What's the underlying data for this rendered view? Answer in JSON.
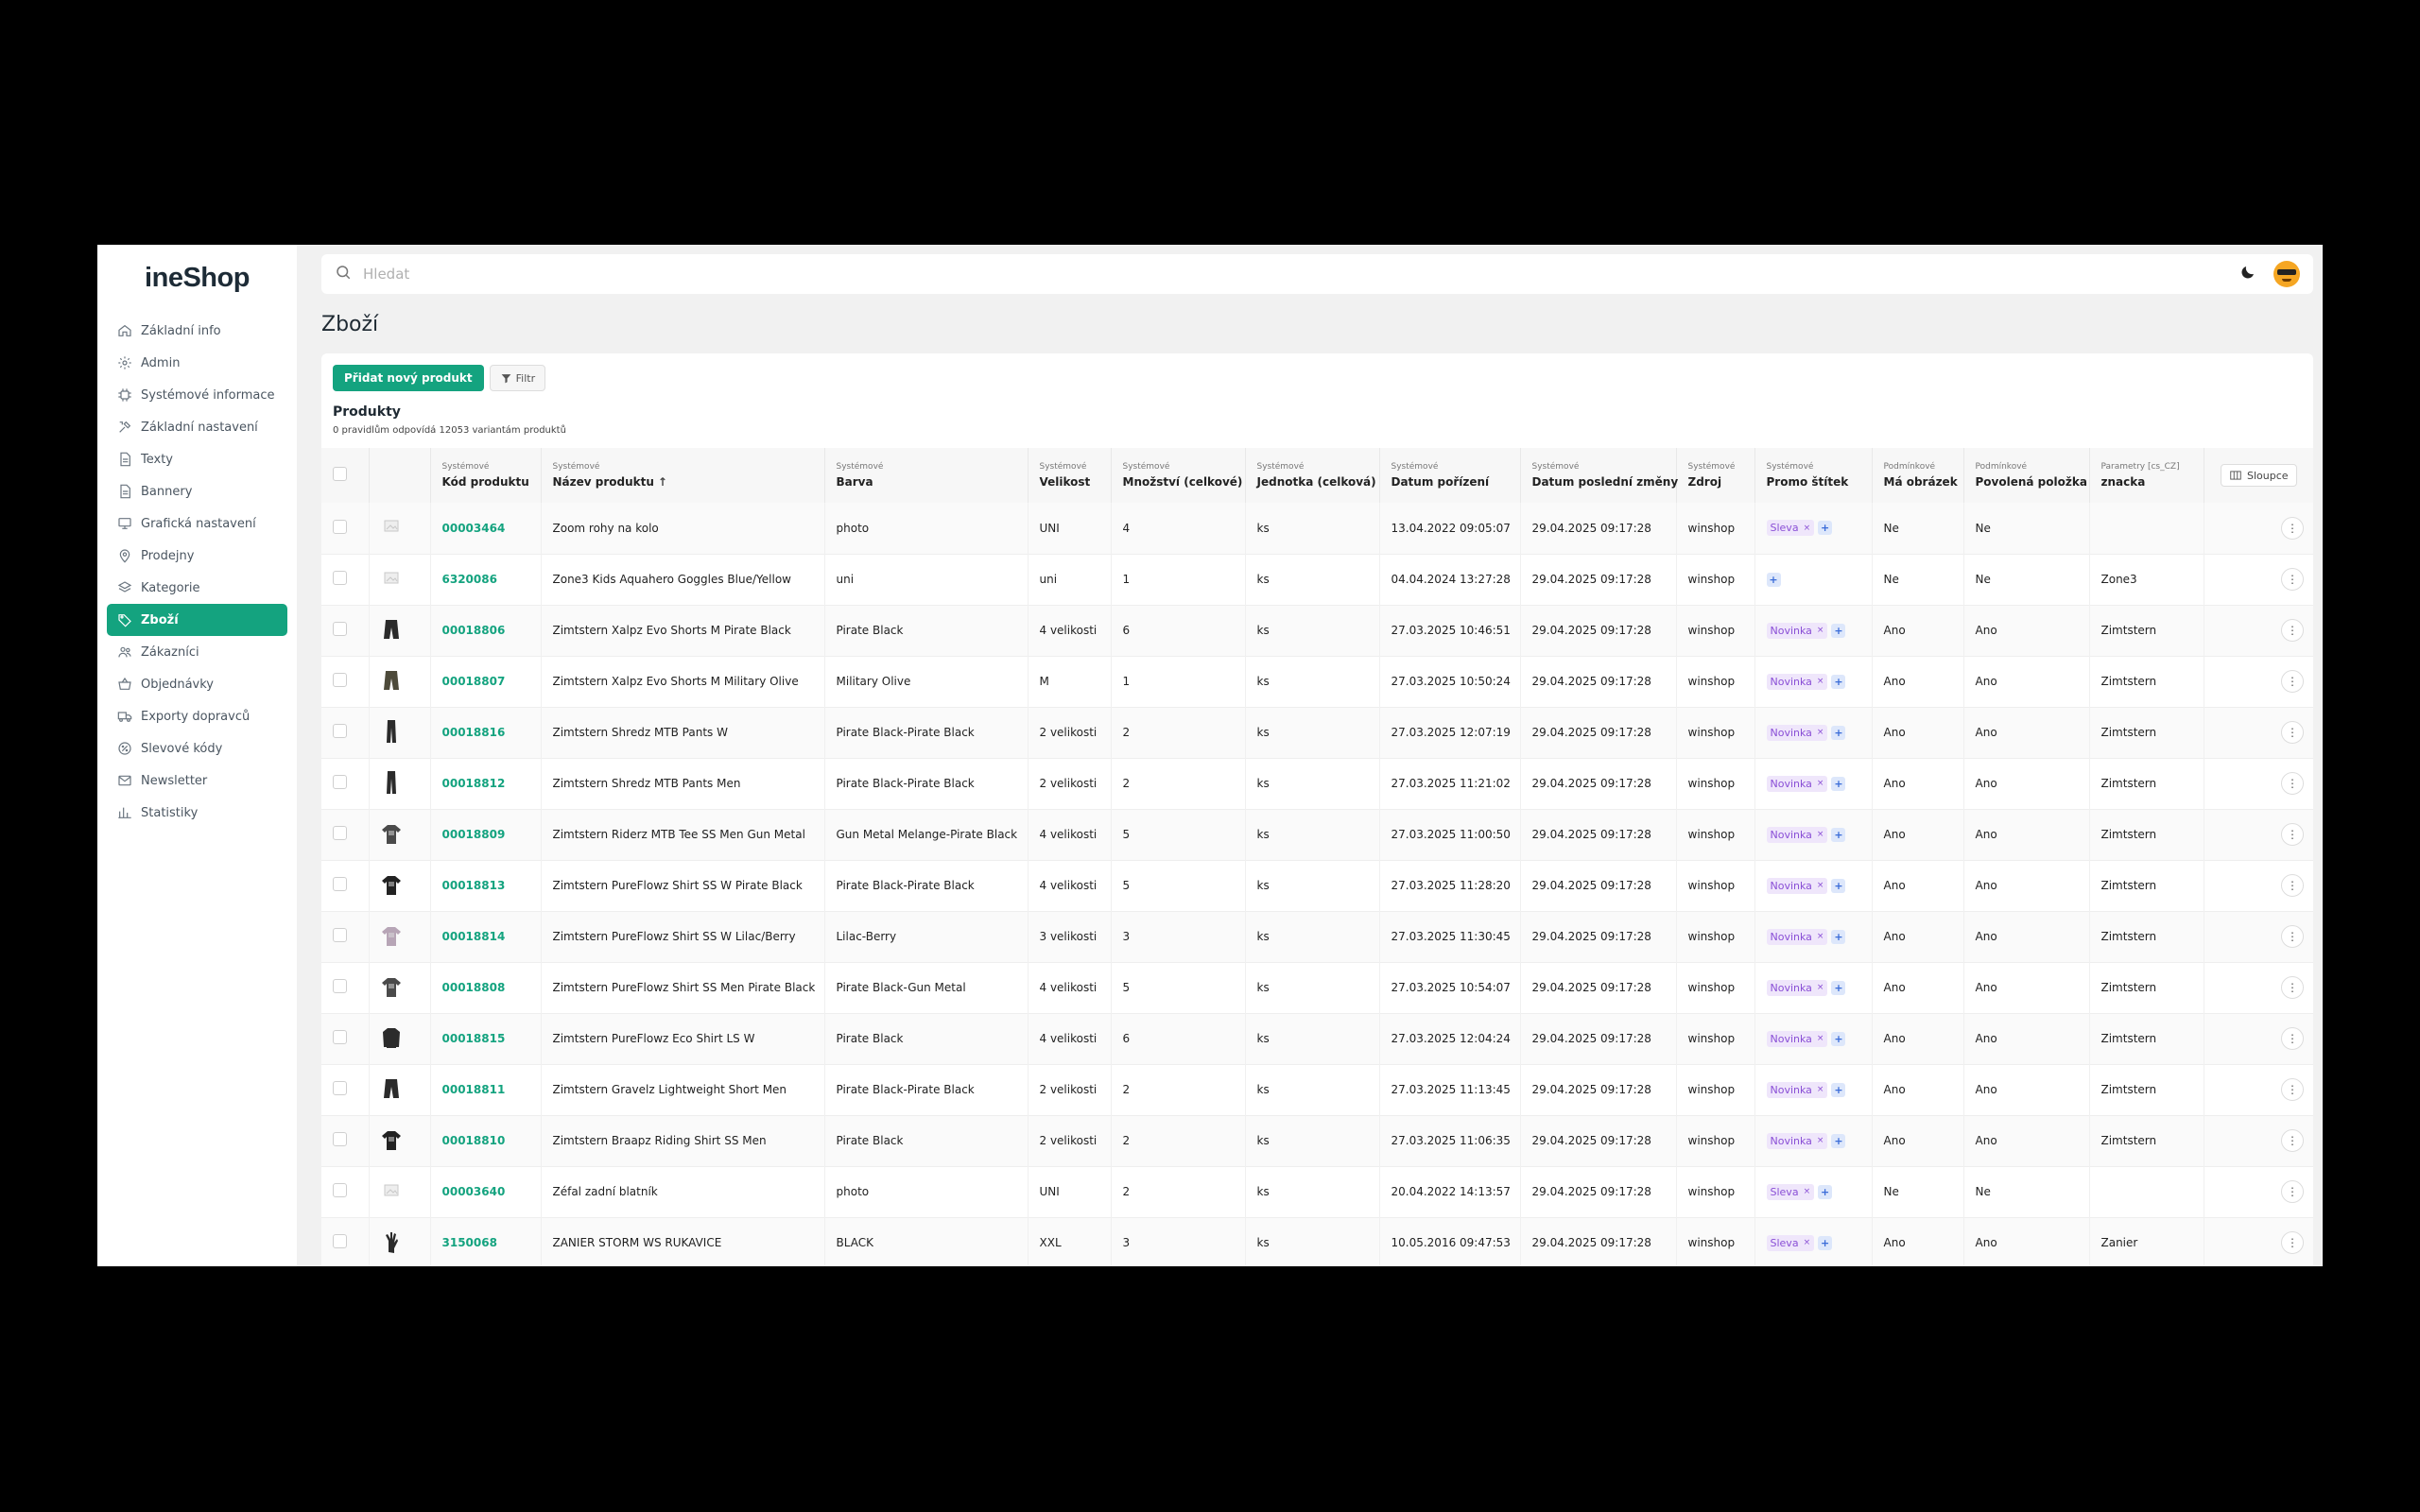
{
  "app": {
    "logo": "ineShop"
  },
  "colors": {
    "accent": "#14a37f",
    "tag_bg": "#efe6fb",
    "tag_text": "#8a4fd6",
    "plus_bg": "#dde7fb"
  },
  "sidebar": {
    "items": [
      {
        "label": "Základní info",
        "icon": "home-icon"
      },
      {
        "label": "Admin",
        "icon": "gear-icon"
      },
      {
        "label": "Systémové informace",
        "icon": "chip-icon"
      },
      {
        "label": "Základní nastavení",
        "icon": "tools-icon"
      },
      {
        "label": "Texty",
        "icon": "document-icon"
      },
      {
        "label": "Bannery",
        "icon": "document-icon"
      },
      {
        "label": "Grafická nastavení",
        "icon": "monitor-icon"
      },
      {
        "label": "Prodejny",
        "icon": "location-pin-icon"
      },
      {
        "label": "Kategorie",
        "icon": "layers-icon"
      },
      {
        "label": "Zboží",
        "icon": "tag-icon",
        "active": true
      },
      {
        "label": "Zákazníci",
        "icon": "users-icon"
      },
      {
        "label": "Objednávky",
        "icon": "basket-icon"
      },
      {
        "label": "Exporty dopravců",
        "icon": "truck-icon"
      },
      {
        "label": "Slevové kódy",
        "icon": "discount-icon"
      },
      {
        "label": "Newsletter",
        "icon": "mail-icon"
      },
      {
        "label": "Statistiky",
        "icon": "chart-icon"
      }
    ]
  },
  "search": {
    "placeholder": "Hledat"
  },
  "page": {
    "title": "Zboží"
  },
  "toolbar": {
    "add_label": "Přidat nový produkt",
    "filter_label": "Filtr"
  },
  "products": {
    "title": "Produkty",
    "subtitle": "0 pravidlům odpovídá 12053 variantám produktů",
    "columns_button": "Sloupce",
    "columns": [
      {
        "sys": "Systémové",
        "name": "Kód produktu"
      },
      {
        "sys": "Systémové",
        "name": "Název produktu"
      },
      {
        "sys": "Systémové",
        "name": "Barva"
      },
      {
        "sys": "Systémové",
        "name": "Velikost"
      },
      {
        "sys": "Systémové",
        "name": "Množství (celkové)"
      },
      {
        "sys": "Systémové",
        "name": "Jednotka (celková)"
      },
      {
        "sys": "Systémové",
        "name": "Datum pořízení"
      },
      {
        "sys": "Systémové",
        "name": "Datum poslední změny"
      },
      {
        "sys": "Systémové",
        "name": "Zdroj"
      },
      {
        "sys": "Systémové",
        "name": "Promo štítek"
      },
      {
        "sys": "Podmínkové",
        "name": "Má obrázek"
      },
      {
        "sys": "Podmínkové",
        "name": "Povolená položka"
      },
      {
        "sys": "Parametry [cs_CZ]",
        "name": "znacka"
      }
    ],
    "rows": [
      {
        "img": "placeholder",
        "code": "00003464",
        "name": "Zoom rohy na kolo",
        "color": "photo",
        "size": "UNI",
        "qty": "4",
        "unit": "ks",
        "date_acq": "13.04.2022 09:05:07",
        "date_mod": "29.04.2025 09:17:28",
        "source": "winshop",
        "promo": "Sleva",
        "has_img": "Ne",
        "allowed": "Ne",
        "brand": ""
      },
      {
        "img": "placeholder",
        "code": "6320086",
        "name": "Zone3 Kids Aquahero Goggles Blue/Yellow",
        "color": "uni",
        "size": "uni",
        "qty": "1",
        "unit": "ks",
        "date_acq": "04.04.2024 13:27:28",
        "date_mod": "29.04.2025 09:17:28",
        "source": "winshop",
        "promo": "",
        "has_img": "Ne",
        "allowed": "Ne",
        "brand": "Zone3"
      },
      {
        "img": "shorts",
        "code": "00018806",
        "name": "Zimtstern Xalpz Evo Shorts M Pirate Black",
        "color": "Pirate Black",
        "size": "4 velikosti",
        "qty": "6",
        "unit": "ks",
        "date_acq": "27.03.2025 10:46:51",
        "date_mod": "29.04.2025 09:17:28",
        "source": "winshop",
        "promo": "Novinka",
        "has_img": "Ano",
        "allowed": "Ano",
        "brand": "Zimtstern"
      },
      {
        "img": "shorts-olive",
        "code": "00018807",
        "name": "Zimtstern Xalpz Evo Shorts M Military Olive",
        "color": "Military Olive",
        "size": "M",
        "qty": "1",
        "unit": "ks",
        "date_acq": "27.03.2025 10:50:24",
        "date_mod": "29.04.2025 09:17:28",
        "source": "winshop",
        "promo": "Novinka",
        "has_img": "Ano",
        "allowed": "Ano",
        "brand": "Zimtstern"
      },
      {
        "img": "pants",
        "code": "00018816",
        "name": "Zimtstern Shredz MTB Pants W",
        "color": "Pirate Black-Pirate Black",
        "size": "2 velikosti",
        "qty": "2",
        "unit": "ks",
        "date_acq": "27.03.2025 12:07:19",
        "date_mod": "29.04.2025 09:17:28",
        "source": "winshop",
        "promo": "Novinka",
        "has_img": "Ano",
        "allowed": "Ano",
        "brand": "Zimtstern"
      },
      {
        "img": "pants",
        "code": "00018812",
        "name": "Zimtstern Shredz MTB Pants Men",
        "color": "Pirate Black-Pirate Black",
        "size": "2 velikosti",
        "qty": "2",
        "unit": "ks",
        "date_acq": "27.03.2025 11:21:02",
        "date_mod": "29.04.2025 09:17:28",
        "source": "winshop",
        "promo": "Novinka",
        "has_img": "Ano",
        "allowed": "Ano",
        "brand": "Zimtstern"
      },
      {
        "img": "tee",
        "code": "00018809",
        "name": "Zimtstern Riderz MTB Tee SS Men Gun Metal",
        "color": "Gun Metal Melange-Pirate Black",
        "size": "4 velikosti",
        "qty": "5",
        "unit": "ks",
        "date_acq": "27.03.2025 11:00:50",
        "date_mod": "29.04.2025 09:17:28",
        "source": "winshop",
        "promo": "Novinka",
        "has_img": "Ano",
        "allowed": "Ano",
        "brand": "Zimtstern"
      },
      {
        "img": "tee-dark",
        "code": "00018813",
        "name": "Zimtstern PureFlowz Shirt SS W Pirate Black",
        "color": "Pirate Black-Pirate Black",
        "size": "4 velikosti",
        "qty": "5",
        "unit": "ks",
        "date_acq": "27.03.2025 11:28:20",
        "date_mod": "29.04.2025 09:17:28",
        "source": "winshop",
        "promo": "Novinka",
        "has_img": "Ano",
        "allowed": "Ano",
        "brand": "Zimtstern"
      },
      {
        "img": "tee-lilac",
        "code": "00018814",
        "name": "Zimtstern PureFlowz Shirt SS W Lilac/Berry",
        "color": "Lilac-Berry",
        "size": "3 velikosti",
        "qty": "3",
        "unit": "ks",
        "date_acq": "27.03.2025 11:30:45",
        "date_mod": "29.04.2025 09:17:28",
        "source": "winshop",
        "promo": "Novinka",
        "has_img": "Ano",
        "allowed": "Ano",
        "brand": "Zimtstern"
      },
      {
        "img": "tee",
        "code": "00018808",
        "name": "Zimtstern PureFlowz Shirt SS Men Pirate Black",
        "color": "Pirate Black-Gun Metal",
        "size": "4 velikosti",
        "qty": "5",
        "unit": "ks",
        "date_acq": "27.03.2025 10:54:07",
        "date_mod": "29.04.2025 09:17:28",
        "source": "winshop",
        "promo": "Novinka",
        "has_img": "Ano",
        "allowed": "Ano",
        "brand": "Zimtstern"
      },
      {
        "img": "longsleeve",
        "code": "00018815",
        "name": "Zimtstern PureFlowz Eco Shirt LS W",
        "color": "Pirate Black",
        "size": "4 velikosti",
        "qty": "6",
        "unit": "ks",
        "date_acq": "27.03.2025 12:04:24",
        "date_mod": "29.04.2025 09:17:28",
        "source": "winshop",
        "promo": "Novinka",
        "has_img": "Ano",
        "allowed": "Ano",
        "brand": "Zimtstern"
      },
      {
        "img": "shorts",
        "code": "00018811",
        "name": "Zimtstern Gravelz Lightweight Short Men",
        "color": "Pirate Black-Pirate Black",
        "size": "2 velikosti",
        "qty": "2",
        "unit": "ks",
        "date_acq": "27.03.2025 11:13:45",
        "date_mod": "29.04.2025 09:17:28",
        "source": "winshop",
        "promo": "Novinka",
        "has_img": "Ano",
        "allowed": "Ano",
        "brand": "Zimtstern"
      },
      {
        "img": "tee-dark",
        "code": "00018810",
        "name": "Zimtstern Braapz Riding Shirt SS Men",
        "color": "Pirate Black",
        "size": "2 velikosti",
        "qty": "2",
        "unit": "ks",
        "date_acq": "27.03.2025 11:06:35",
        "date_mod": "29.04.2025 09:17:28",
        "source": "winshop",
        "promo": "Novinka",
        "has_img": "Ano",
        "allowed": "Ano",
        "brand": "Zimtstern"
      },
      {
        "img": "placeholder",
        "code": "00003640",
        "name": "Zéfal zadní blatník",
        "color": "photo",
        "size": "UNI",
        "qty": "2",
        "unit": "ks",
        "date_acq": "20.04.2022 14:13:57",
        "date_mod": "29.04.2025 09:17:28",
        "source": "winshop",
        "promo": "Sleva",
        "has_img": "Ne",
        "allowed": "Ne",
        "brand": ""
      },
      {
        "img": "glove",
        "code": "3150068",
        "name": "ZANIER STORM WS RUKAVICE",
        "color": "BLACK",
        "size": "XXL",
        "qty": "3",
        "unit": "ks",
        "date_acq": "10.05.2016 09:47:53",
        "date_mod": "29.04.2025 09:17:28",
        "source": "winshop",
        "promo": "Sleva",
        "has_img": "Ano",
        "allowed": "Ano",
        "brand": "Zanier"
      }
    ]
  }
}
